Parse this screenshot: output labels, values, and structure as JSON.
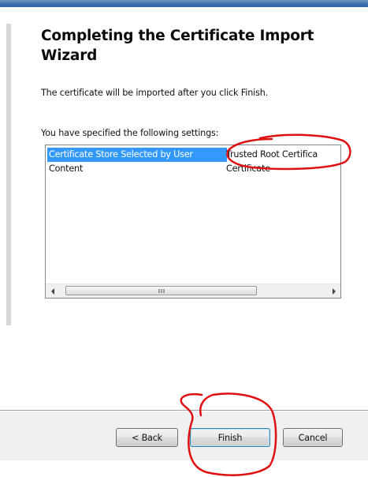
{
  "wizard": {
    "title": "Completing the Certificate Import Wizard",
    "description": "The certificate will be imported after you click Finish.",
    "settings_label": "You have specified the following settings:"
  },
  "settings_list": {
    "rows": [
      {
        "name": "Certificate Store Selected by User",
        "value": "Trusted Root Certifica",
        "selected": true
      },
      {
        "name": "Content",
        "value": "Certificate",
        "selected": false
      }
    ],
    "scrollbar": {
      "grip_glyph": "III",
      "left_arrow_icon": "scroll-left-arrow",
      "right_arrow_icon": "scroll-right-arrow"
    }
  },
  "buttons": {
    "back_label": "< Back",
    "finish_label": "Finish",
    "cancel_label": "Cancel"
  },
  "colors": {
    "selection_highlight": "#3399ff",
    "annotation_red": "#e01010",
    "title_bar_blue": "#3a6fb0"
  }
}
